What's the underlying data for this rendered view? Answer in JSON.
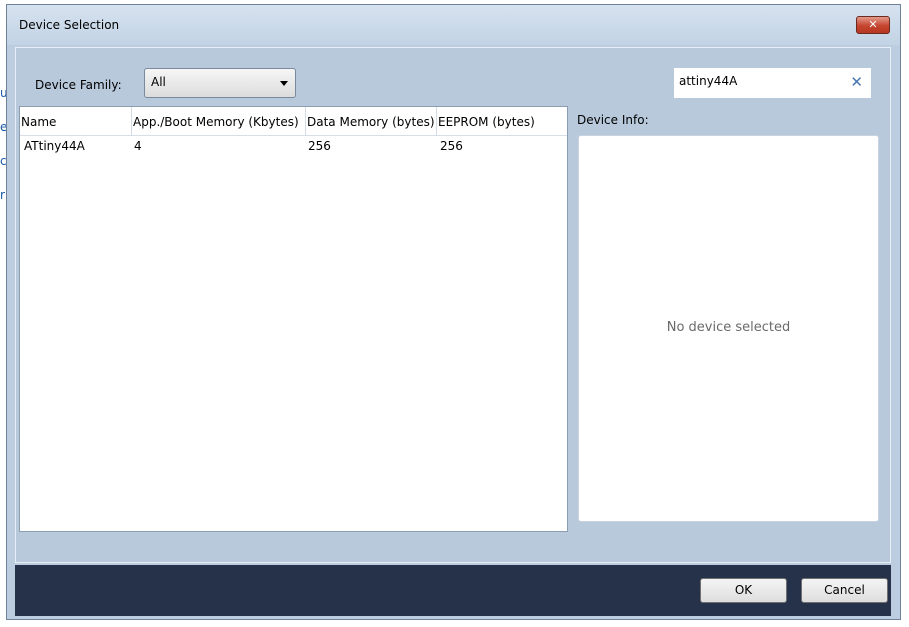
{
  "dialog": {
    "title": "Device Selection",
    "close_label": "✕"
  },
  "filter": {
    "device_family_label": "Device Family:",
    "device_family_value": "All",
    "search_value": "attiny44A",
    "clear_icon": "✕"
  },
  "table": {
    "columns": [
      "Name",
      "App./Boot Memory (Kbytes)",
      "Data Memory (bytes)",
      "EEPROM (bytes)"
    ],
    "rows": [
      [
        "ATtiny44A",
        "4",
        "256",
        "256"
      ]
    ]
  },
  "device_info": {
    "label": "Device Info:",
    "empty_message": "No device selected"
  },
  "footer": {
    "ok_label": "OK",
    "cancel_label": "Cancel"
  },
  "background_fragments": [
    "u",
    "e",
    "c",
    "r"
  ]
}
